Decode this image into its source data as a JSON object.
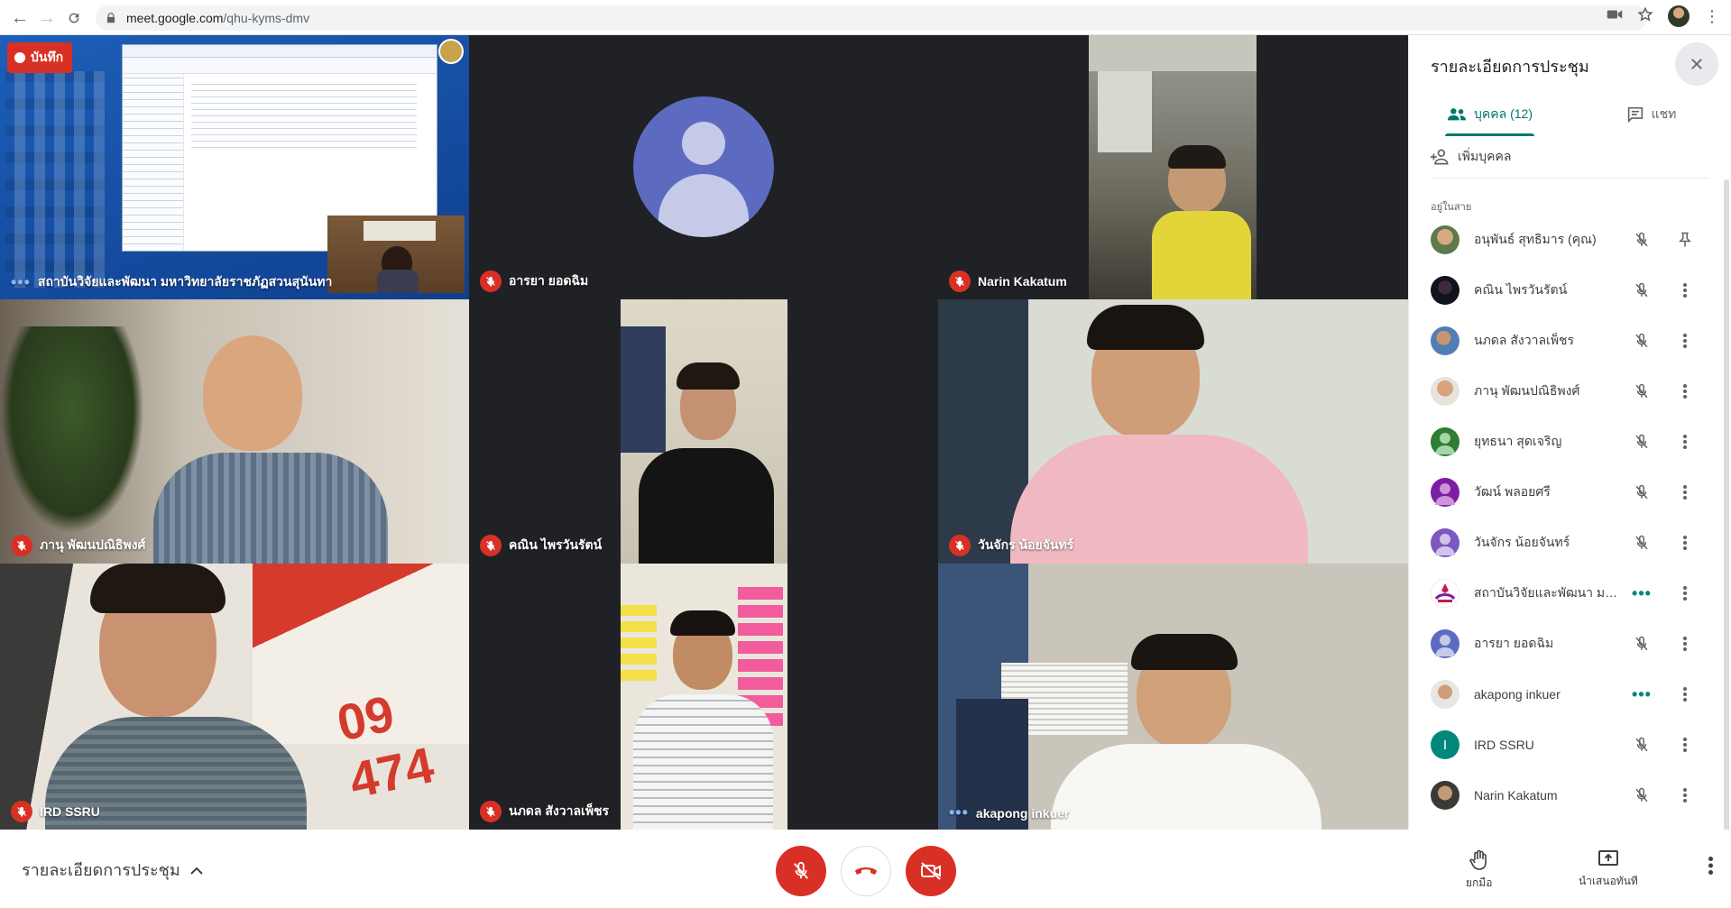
{
  "browser": {
    "url_host": "meet.google.com",
    "url_path": "/qhu-kyms-dmv"
  },
  "recording": {
    "label": "บันทึก"
  },
  "tiles": [
    {
      "name": "สถาบันวิจัยและพัฒนา มหาวิทยาลัยราชภัฏสวนสุนันทา",
      "state": "speaking"
    },
    {
      "name": "อารยา ยอดฉิม",
      "state": "muted"
    },
    {
      "name": "Narin Kakatum",
      "state": "muted"
    },
    {
      "name": "ภานุ พัฒนปณิธิพงศ์",
      "state": "muted"
    },
    {
      "name": "คณิน ไพรวันรัตน์",
      "state": "muted"
    },
    {
      "name": "วันจักร น้อยจันทร์",
      "state": "muted"
    },
    {
      "name": "IRD SSRU",
      "state": "muted"
    },
    {
      "name": "นภดล สังวาลเพ็ชร",
      "state": "muted"
    },
    {
      "name": "akapong inkuer",
      "state": "speaking"
    }
  ],
  "sidebar": {
    "title": "รายละเอียดการประชุม",
    "tabs": [
      {
        "label": "บุคคล (12)",
        "icon": "people-icon"
      },
      {
        "label": "แชท",
        "icon": "chat-icon"
      }
    ],
    "add_people": "เพิ่มบุคคล",
    "section_label": "อยู่ในสาย",
    "people": [
      {
        "name": "อนุพันธ์ สุทธิมาร (คุณ)",
        "status": "muted",
        "action": "pin"
      },
      {
        "name": "คณิน ไพรวันรัตน์",
        "status": "muted",
        "action": "more"
      },
      {
        "name": "นภดล สังวาลเพ็ชร",
        "status": "muted",
        "action": "more"
      },
      {
        "name": "ภานุ พัฒนปณิธิพงศ์",
        "status": "muted",
        "action": "more"
      },
      {
        "name": "ยุทธนา สุดเจริญ",
        "status": "muted",
        "action": "more"
      },
      {
        "name": "วัฒน์ พลอยศรี",
        "status": "muted",
        "action": "more"
      },
      {
        "name": "วันจักร น้อยจันทร์",
        "status": "muted",
        "action": "more"
      },
      {
        "name": "สถาบันวิจัยและพัฒนา มห...",
        "status": "speaking",
        "action": "more"
      },
      {
        "name": "อารยา ยอดฉิม",
        "status": "muted",
        "action": "more"
      },
      {
        "name": "akapong inkuer",
        "status": "speaking",
        "action": "more"
      },
      {
        "name": "IRD SSRU",
        "status": "muted",
        "action": "more",
        "initial": "I"
      },
      {
        "name": "Narin Kakatum",
        "status": "muted",
        "action": "more"
      }
    ]
  },
  "bottom": {
    "meeting_details": "รายละเอียดการประชุม",
    "raise_hand": "ยกมือ",
    "present_now": "นำเสนอทันที"
  },
  "colors": {
    "accent": "#00796b",
    "danger": "#d93025",
    "grid_bg": "#202124"
  }
}
